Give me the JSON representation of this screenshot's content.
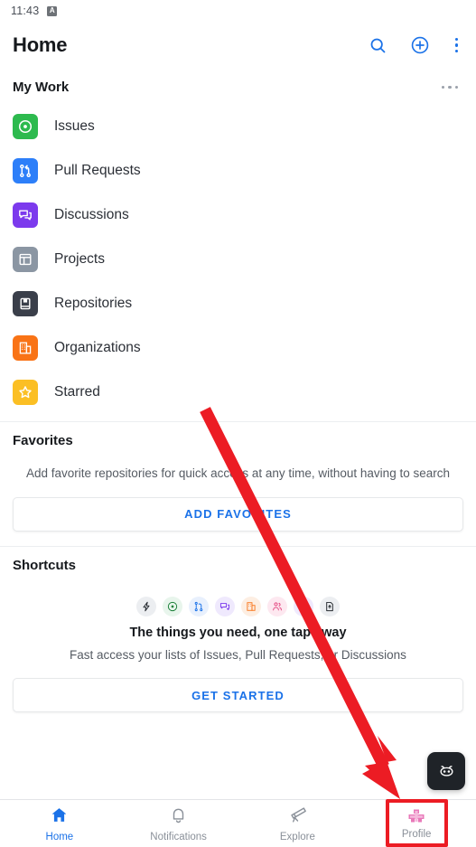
{
  "status_bar": {
    "time": "11:43",
    "icon_glyph": "A",
    "icon_name": "app-badge-icon"
  },
  "app_bar": {
    "title": "Home",
    "actions": [
      {
        "name": "search-icon",
        "label": "Search"
      },
      {
        "name": "plus-circle-icon",
        "label": "Create new"
      },
      {
        "name": "overflow-menu-icon",
        "label": "More options"
      }
    ]
  },
  "my_work": {
    "title": "My Work",
    "overflow_label": "More",
    "items": [
      {
        "label": "Issues",
        "icon": "issue-opened-icon",
        "color": "#2dba4e"
      },
      {
        "label": "Pull Requests",
        "icon": "git-pull-request-icon",
        "color": "#2d7ff9"
      },
      {
        "label": "Discussions",
        "icon": "comment-discussion-icon",
        "color": "#7c3aed"
      },
      {
        "label": "Projects",
        "icon": "project-table-icon",
        "color": "#8b96a3"
      },
      {
        "label": "Repositories",
        "icon": "repo-icon",
        "color": "#3a3f4a"
      },
      {
        "label": "Organizations",
        "icon": "organization-icon",
        "color": "#f97316"
      },
      {
        "label": "Starred",
        "icon": "star-icon",
        "color": "#fbbf24"
      }
    ]
  },
  "favorites": {
    "title": "Favorites",
    "description": "Add favorite repositories for quick access at any time, without having to search",
    "button_label": "ADD FAVORITES"
  },
  "shortcuts": {
    "title": "Shortcuts",
    "headline": "The things you need, one tap away",
    "description": "Fast access your lists of Issues, Pull Requests, or Discussions",
    "button_label": "GET STARTED",
    "chips": [
      {
        "icon": "zap-icon",
        "color": "#24292f",
        "bg": "#eceef1"
      },
      {
        "icon": "issue-opened-icon",
        "color": "#1a7f37",
        "bg": "#e8f5ec"
      },
      {
        "icon": "git-pull-request-icon",
        "color": "#1b72e8",
        "bg": "#e8f0fd"
      },
      {
        "icon": "comment-discussion-icon",
        "color": "#7c3aed",
        "bg": "#efe9fd"
      },
      {
        "icon": "organization-icon",
        "color": "#f97316",
        "bg": "#fdeee2"
      },
      {
        "icon": "people-icon",
        "color": "#e4467f",
        "bg": "#fde8f0"
      },
      {
        "icon": "briefcase-icon",
        "color": "#7c3aed",
        "bg": "#efe9fd"
      },
      {
        "icon": "file-badge-icon",
        "color": "#24292f",
        "bg": "#eceef1"
      }
    ]
  },
  "fab": {
    "name": "copilot-icon",
    "label": "Copilot"
  },
  "bottom_nav": {
    "active": "Home",
    "items": [
      {
        "label": "Home",
        "icon": "home-icon",
        "active": true
      },
      {
        "label": "Notifications",
        "icon": "bell-icon",
        "active": false
      },
      {
        "label": "Explore",
        "icon": "telescope-icon",
        "active": false
      },
      {
        "label": "Profile",
        "icon": "avatar-icon",
        "active": false
      }
    ]
  },
  "annotation": {
    "arrow_color": "#ec1c24",
    "highlight_color": "#ec1c24",
    "target": "Profile"
  },
  "colors": {
    "accent_blue": "#1b72e8",
    "text_primary": "#16191d",
    "text_secondary": "#555b63",
    "divider": "#eceef0"
  }
}
